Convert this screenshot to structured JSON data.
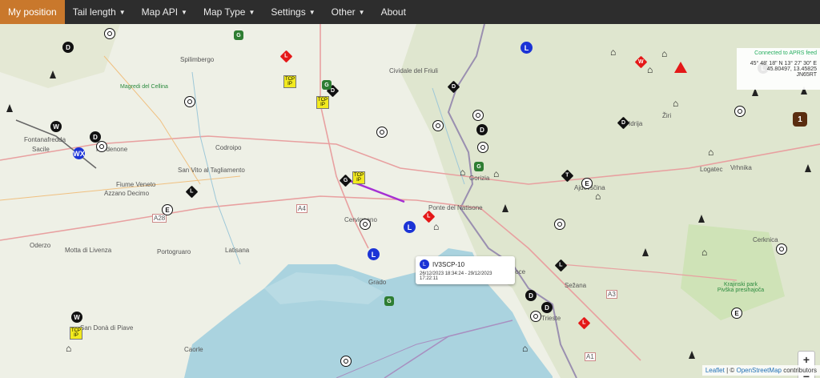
{
  "nav": {
    "my_position": "My position",
    "tail_length": "Tail length",
    "map_api": "Map API",
    "map_type": "Map Type",
    "settings": "Settings",
    "other": "Other",
    "about": "About"
  },
  "status": {
    "connection": "Connected to APRS feed",
    "dms": "45° 48' 18\" N 13° 27' 30\" E",
    "decimal": "45.80497, 13.45825",
    "locator": "JN65RT"
  },
  "popup": {
    "icon_letter": "L",
    "callsign": "IV3SCP-10",
    "dates": "26/12/2023 18:34:24 - 29/12/2023 17:22:11"
  },
  "zoom": {
    "in": "+",
    "out": "−"
  },
  "attribution": {
    "leaflet": "Leaflet",
    "sep": " | © ",
    "osm": "OpenStreetMap",
    "contrib": " contributors"
  },
  "places": {
    "spilimbergo": "Spilimbergo",
    "cividale": "Cividale del Friuli",
    "fontanafredda": "Fontanafredda",
    "sacile": "Sacile",
    "pordenone": "Pordenone",
    "fiume_veneto": "Fiume Veneto",
    "san_vito": "San Vito al Tagliamento",
    "codroipo": "Codroipo",
    "azzano": "Azzano Decimo",
    "oderzo": "Oderzo",
    "motta": "Motta di Livenza",
    "portogruaro": "Portogruaro",
    "latisana": "Latisana",
    "san_dona": "San Donà di Piave",
    "caorle": "Caorle",
    "cervignano": "Cervignano",
    "sezana": "Sežana",
    "cerknica": "Cerknica",
    "vrhnika": "Vrhnika",
    "logatec": "Logatec",
    "idrija": "Idrija",
    "ziri": "Žiri",
    "ajdovscina": "Ajdovščina",
    "krajinski": "Krajinski park Pivška presihajoča",
    "magredi": "Magredi del Cellina",
    "ponte": "Ponte del Natisone",
    "gorizia": "Gorizia",
    "s_croce": "S. Croce",
    "grado": "Grado",
    "trieste": "Trieste"
  },
  "roads": {
    "a28": "A28",
    "a4": "A4",
    "a3": "A3",
    "a1": "A1"
  },
  "markers": {
    "L": "L",
    "D": "D",
    "W": "W",
    "E": "E",
    "T": "T",
    "G": "G",
    "WX": "WX",
    "tcp": "TCP IP",
    "one": "1"
  },
  "colors": {
    "nav_bg": "#2d2d2d",
    "active_tab": "#c9782c",
    "sea": "#aad3df",
    "land": "#eef0e6",
    "track": "#a52fd3"
  }
}
